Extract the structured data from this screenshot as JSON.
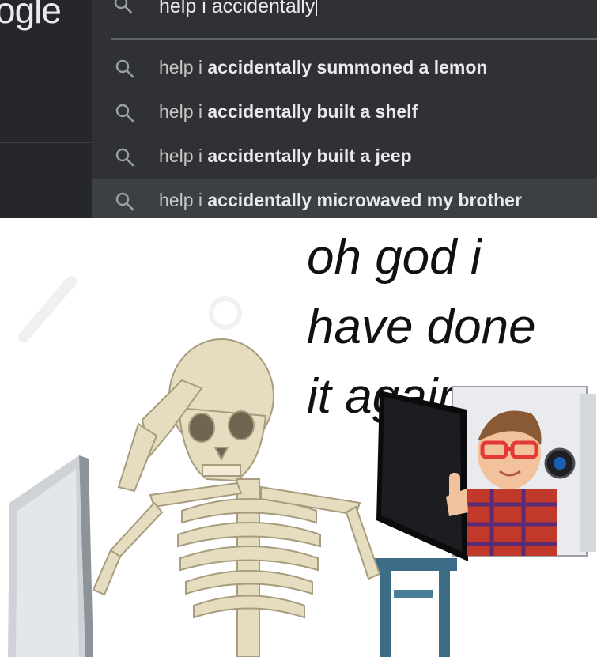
{
  "search": {
    "logo_text": "ogle",
    "query": "help i accidentally",
    "suggestions": [
      {
        "prefix": "help i ",
        "completion": "accidentally summoned a lemon",
        "highlighted": false
      },
      {
        "prefix": "help i ",
        "completion": "accidentally built a shelf",
        "highlighted": false
      },
      {
        "prefix": "help i ",
        "completion": "accidentally built a jeep",
        "highlighted": false
      },
      {
        "prefix": "help i ",
        "completion": "accidentally microwaved my brother",
        "highlighted": true
      }
    ],
    "icon": "search-icon"
  },
  "meme": {
    "caption": "oh god i\nhave done\nit again",
    "images": [
      "skeleton-at-laptop",
      "kid-with-glasses-thumbs-up-in-microwave"
    ]
  },
  "colors": {
    "page_bg": "#202124",
    "panel_bg": "#303134",
    "highlight_bg": "#3c4043",
    "text": "#e8eaed",
    "meme_bg": "#ffffff"
  }
}
